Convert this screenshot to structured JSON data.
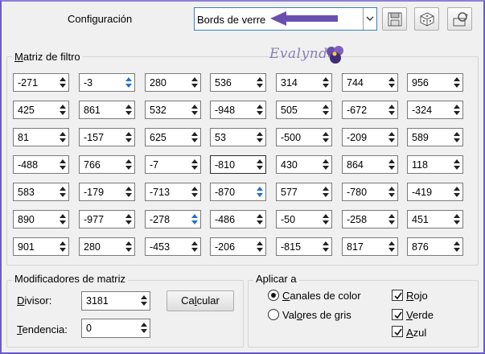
{
  "header": {
    "config_label": "Configuración",
    "preset_value": "Bords de verre"
  },
  "matrix": {
    "title": "Matriz de filtro",
    "watermark": "Evalynda",
    "rows": [
      [
        "-271",
        "-3",
        "280",
        "536",
        "314",
        "744",
        "956"
      ],
      [
        "425",
        "861",
        "532",
        "-948",
        "505",
        "-672",
        "-324"
      ],
      [
        "81",
        "-157",
        "625",
        "53",
        "-500",
        "-209",
        "589"
      ],
      [
        "-488",
        "766",
        "-7",
        "-810",
        "430",
        "864",
        "118"
      ],
      [
        "583",
        "-179",
        "-713",
        "-870",
        "577",
        "-780",
        "-419"
      ],
      [
        "890",
        "-977",
        "-278",
        "-486",
        "-50",
        "-258",
        "451"
      ],
      [
        "901",
        "280",
        "-453",
        "-206",
        "-815",
        "817",
        "876"
      ]
    ]
  },
  "modifiers": {
    "title": "Modificadores de matriz",
    "divisor_label": "Divisor:",
    "divisor_value": "3181",
    "bias_label": "Tendencia:",
    "bias_value": "0",
    "calc_label": "Calcular"
  },
  "apply": {
    "title": "Aplicar a",
    "color_channels": "Canales de color",
    "gray_values": "Valores de gris",
    "red": "Rojo",
    "green": "Verde",
    "blue": "Azul"
  }
}
